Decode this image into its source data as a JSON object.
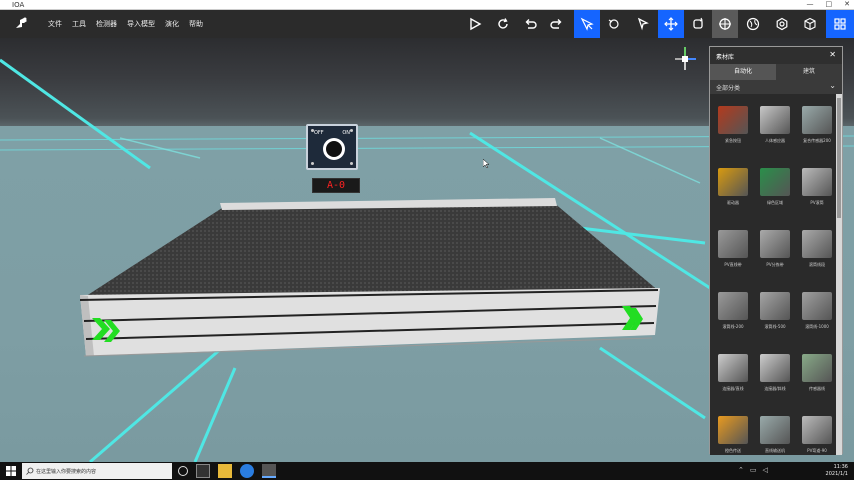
{
  "titlebar": {
    "title": "IOA",
    "controls": [
      "—",
      "□",
      "✕"
    ]
  },
  "menu": {
    "items": [
      "文件",
      "工具",
      "检测器",
      "导入模型",
      "演化",
      "帮助"
    ]
  },
  "toolbar_icons": [
    "play-icon",
    "refresh-icon",
    "undo-icon",
    "redo-icon",
    "select-multi-icon",
    "select-object-icon",
    "pointer-icon",
    "move-icon",
    "rotate-icon",
    "center-icon",
    "globe-icon",
    "settings-icon",
    "cube-icon",
    "grid-icon"
  ],
  "scene": {
    "control_box": {
      "off_label": "OFF",
      "on_label": "ON",
      "display": "A-0"
    }
  },
  "library": {
    "title": "素材库",
    "close": "✕",
    "tabs": [
      "自动化",
      "建筑"
    ],
    "active_tab": 0,
    "filter": "全部分类",
    "items": [
      {
        "name": "紧急按钮",
        "icon": "box-red"
      },
      {
        "name": "人体感应器",
        "icon": "sensor"
      },
      {
        "name": "复合传感器200",
        "icon": "sensor-gray"
      },
      {
        "name": "驱动器",
        "icon": "motor"
      },
      {
        "name": "绿色区域",
        "icon": "green-area"
      },
      {
        "name": "PV滚筒",
        "icon": "roller"
      },
      {
        "name": "PV直线带",
        "icon": "belt"
      },
      {
        "name": "PV分拣带",
        "icon": "belt-split"
      },
      {
        "name": "滚筒线段",
        "icon": "roller-seg"
      },
      {
        "name": "滚筒线-200",
        "icon": "roller-200"
      },
      {
        "name": "滚筒线-500",
        "icon": "roller-500"
      },
      {
        "name": "滚筒线-1000",
        "icon": "roller-1000"
      },
      {
        "name": "连接器/直线",
        "icon": "connector"
      },
      {
        "name": "连接器/斜线",
        "icon": "connector-2"
      },
      {
        "name": "传感器线",
        "icon": "line"
      },
      {
        "name": "橙色传送",
        "icon": "orange"
      },
      {
        "name": "直线输送机",
        "icon": "straight"
      },
      {
        "name": "PV弯道-90",
        "icon": "curve"
      }
    ]
  },
  "taskbar": {
    "search_placeholder": "在这里输入你要搜索的内容",
    "time": "11:36",
    "date": "2021/1/1"
  }
}
